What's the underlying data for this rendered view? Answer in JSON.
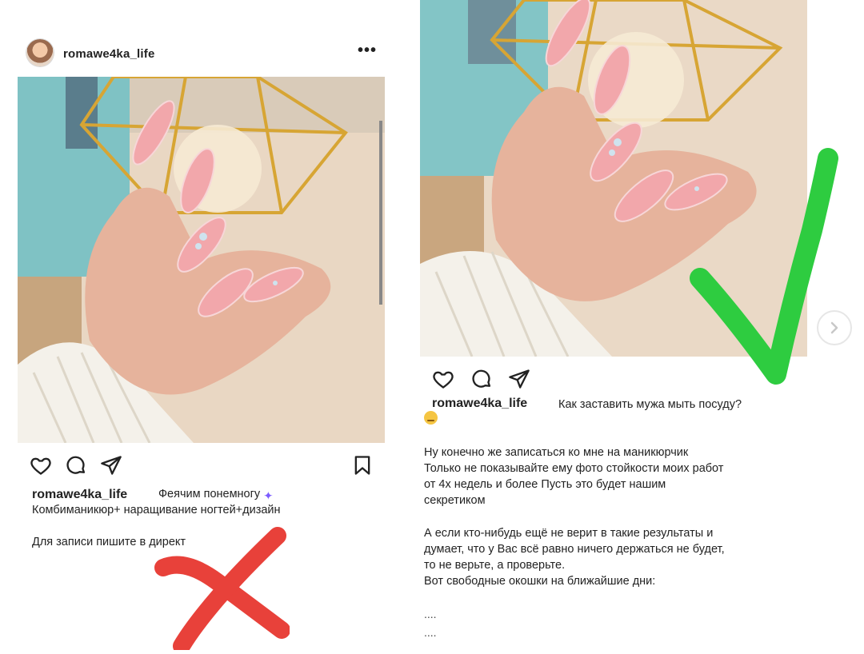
{
  "left_post": {
    "username": "romawe4ka_life",
    "more_label": "•••",
    "caption_user": "romawe4ka_life",
    "caption_text": "Феячим понемногу",
    "caption_emoji": "fairy-emoji",
    "caption_line2": "Комбиманикюр+ наращивание ногтей+дизайн",
    "caption_line3": "Для записи пишите в директ",
    "verdict": "cross-mark"
  },
  "right_post": {
    "caption_user": "romawe4ka_life",
    "caption_text": "Как заставить мужа мыть посуду?",
    "paragraph1": "Ну конечно же записаться ко мне на маникюрчик\nТолько не показывайте ему фото стойкости моих работ\nот 4х недель и более Пусть это будет нашим\nсекретиком",
    "paragraph2": "А если кто-нибудь ещё не верит в такие результаты и\nдумает, что у Вас всё равно ничего держаться не будет,\nто не верьте, а проверьте.\nВот свободные окошки на ближайшие дни:",
    "dots1": "....",
    "dots2": "....",
    "verdict": "check-mark"
  },
  "icons": {
    "like": "heart-icon",
    "comment": "comment-icon",
    "share": "send-icon",
    "bookmark": "bookmark-icon",
    "next": "chevron-right-icon"
  },
  "colors": {
    "cross": "#e8413a",
    "check": "#2ecc40",
    "text": "#222222"
  }
}
